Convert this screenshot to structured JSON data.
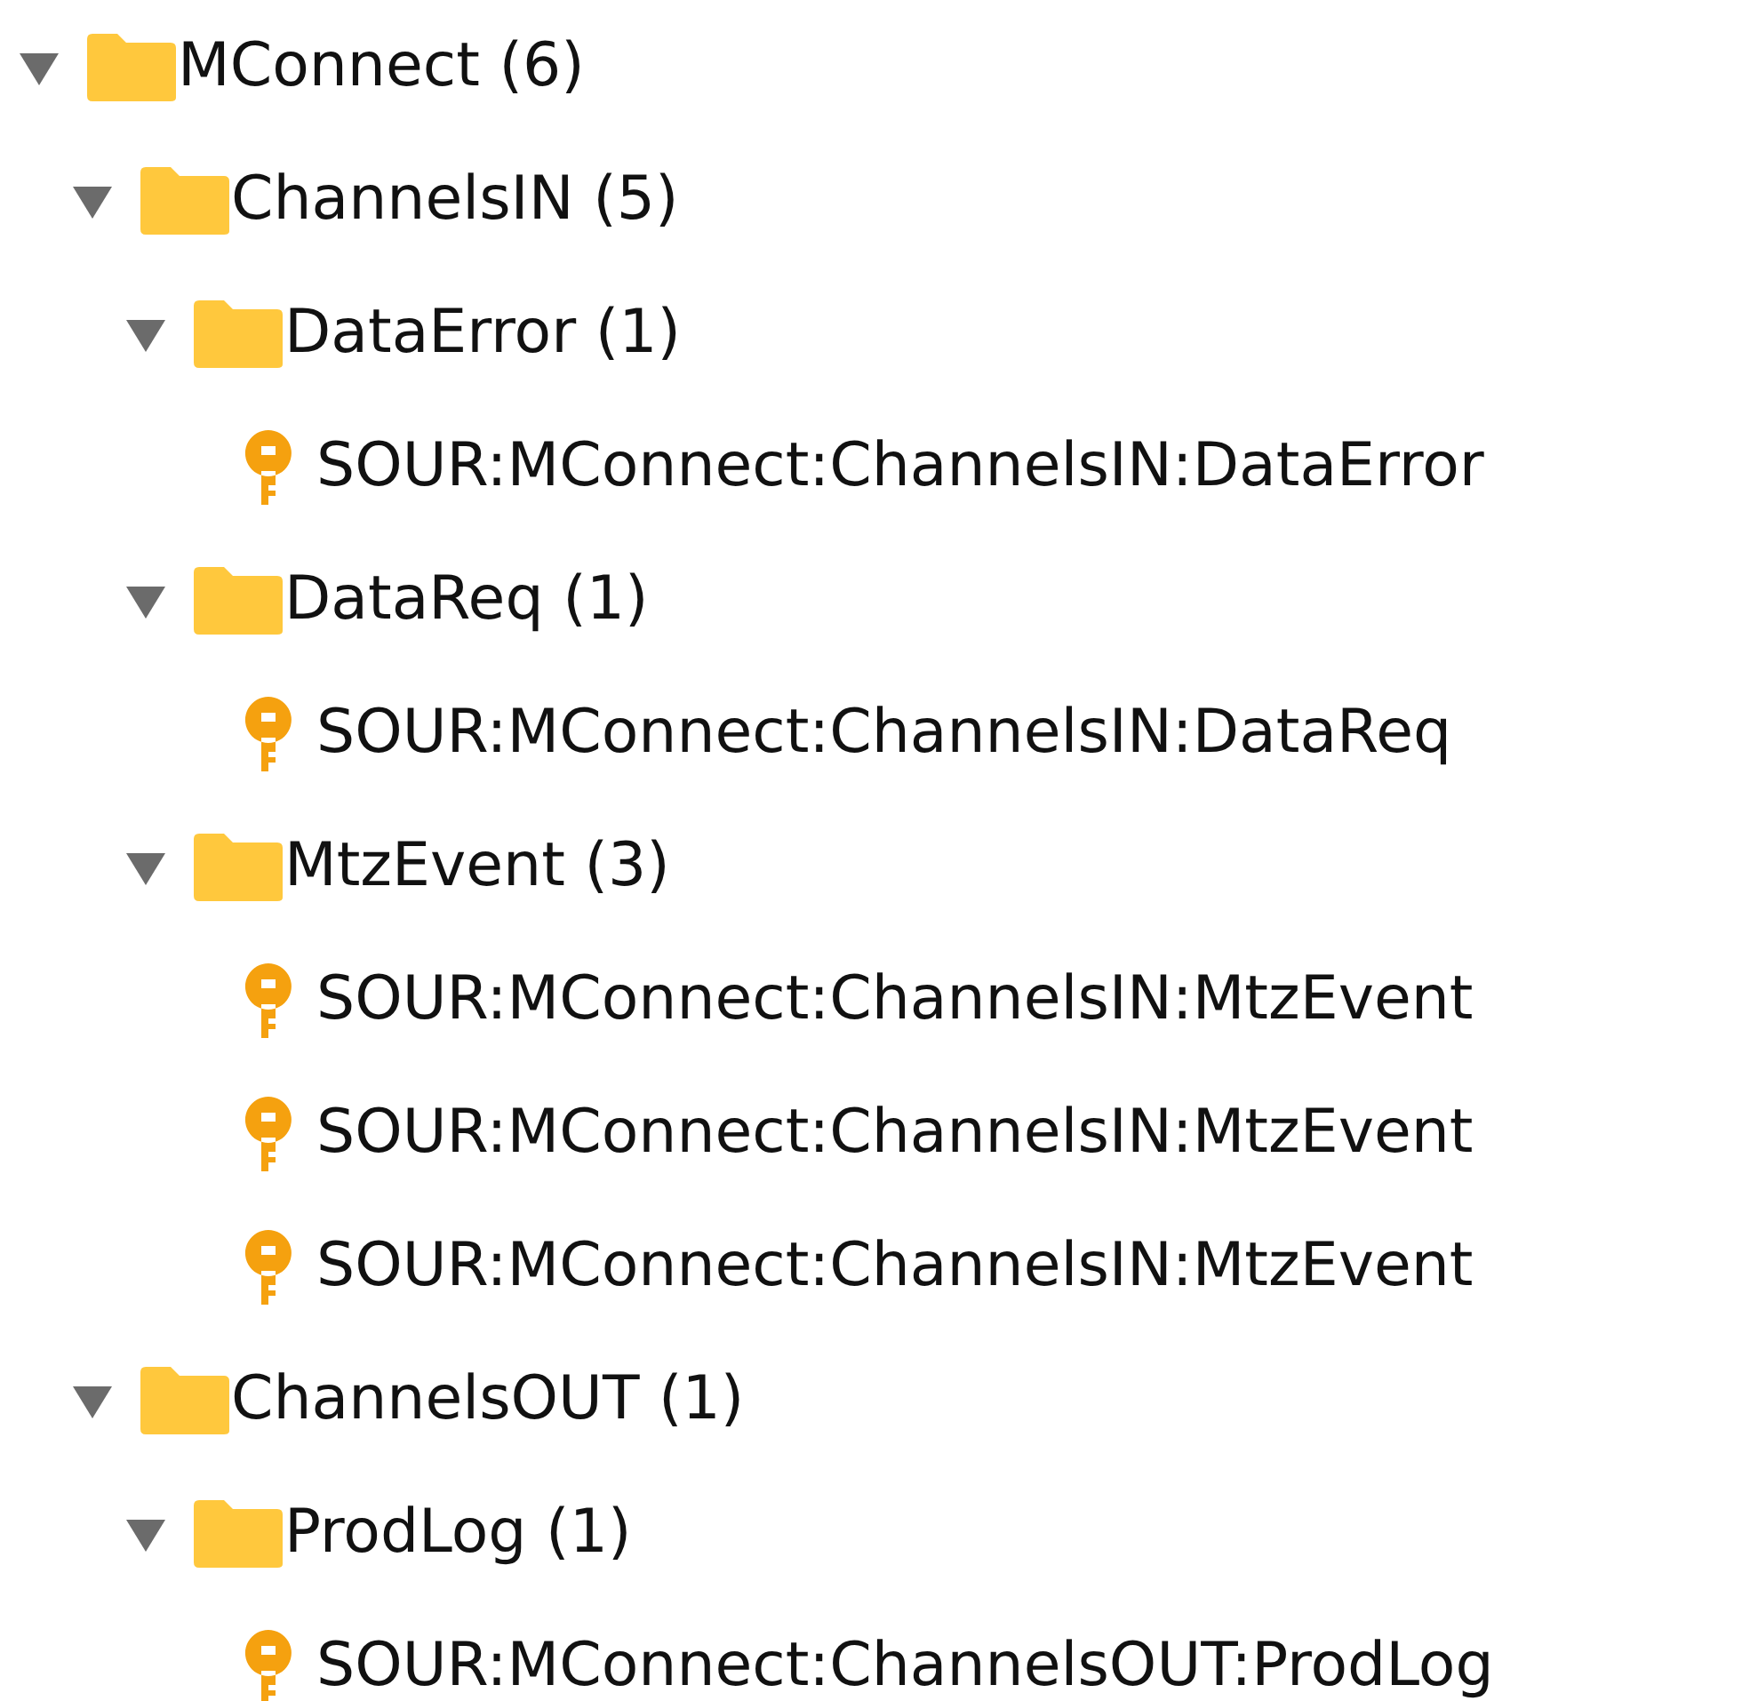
{
  "tree": [
    {
      "kind": "folder",
      "label": "MConnect (6)",
      "expanded": true,
      "children": [
        {
          "kind": "folder",
          "label": "ChannelsIN (5)",
          "expanded": true,
          "children": [
            {
              "kind": "folder",
              "label": "DataError (1)",
              "expanded": true,
              "children": [
                {
                  "kind": "key",
                  "label": "SOUR:MConnect:ChannelsIN:DataError"
                }
              ]
            },
            {
              "kind": "folder",
              "label": "DataReq (1)",
              "expanded": true,
              "children": [
                {
                  "kind": "key",
                  "label": "SOUR:MConnect:ChannelsIN:DataReq"
                }
              ]
            },
            {
              "kind": "folder",
              "label": "MtzEvent (3)",
              "expanded": true,
              "children": [
                {
                  "kind": "key",
                  "label": "SOUR:MConnect:ChannelsIN:MtzEvent"
                },
                {
                  "kind": "key",
                  "label": "SOUR:MConnect:ChannelsIN:MtzEvent"
                },
                {
                  "kind": "key",
                  "label": "SOUR:MConnect:ChannelsIN:MtzEvent"
                }
              ]
            }
          ]
        },
        {
          "kind": "folder",
          "label": "ChannelsOUT (1)",
          "expanded": true,
          "children": [
            {
              "kind": "folder",
              "label": "ProdLog (1)",
              "expanded": true,
              "children": [
                {
                  "kind": "key",
                  "label": "SOUR:MConnect:ChannelsOUT:ProdLog"
                }
              ]
            }
          ]
        }
      ]
    }
  ]
}
